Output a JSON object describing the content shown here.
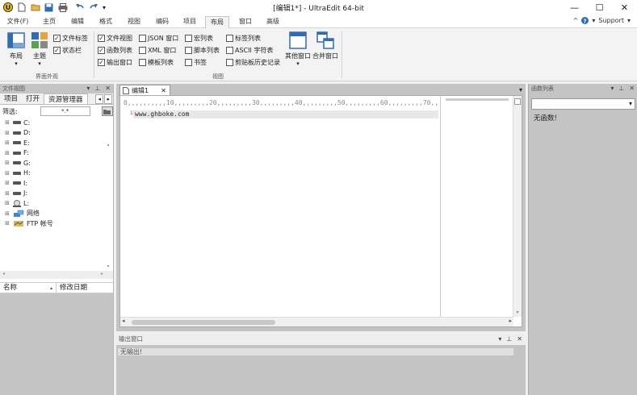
{
  "titlebar": {
    "title": "[编辑1*] - UltraEdit 64-bit",
    "controls": {
      "minimize": "—",
      "maximize": "☐",
      "close": "✕"
    }
  },
  "menu": {
    "tabs": [
      "文件(F)",
      "主页",
      "编辑",
      "格式",
      "视图",
      "编码",
      "项目",
      "布局",
      "窗口",
      "高级"
    ],
    "active": "布局",
    "support": "Support"
  },
  "ribbon": {
    "layout_btn": "布局",
    "theme_btn": "主题",
    "checks_group1": [
      {
        "label": "文件标签",
        "checked": true
      },
      {
        "label": "状态栏",
        "checked": true
      }
    ],
    "checks_col1": [
      {
        "label": "文件视图",
        "checked": true
      },
      {
        "label": "函数列表",
        "checked": true
      },
      {
        "label": "输出窗口",
        "checked": true
      }
    ],
    "checks_col2": [
      {
        "label": "JSON 窗口",
        "checked": false
      },
      {
        "label": "XML 窗口",
        "checked": false
      },
      {
        "label": "模板列表",
        "checked": false
      }
    ],
    "checks_col3": [
      {
        "label": "宏列表",
        "checked": false
      },
      {
        "label": "脚本列表",
        "checked": false
      },
      {
        "label": "书签",
        "checked": false
      }
    ],
    "checks_col4": [
      {
        "label": "标签列表",
        "checked": false
      },
      {
        "label": "ASCII 字符表",
        "checked": false
      },
      {
        "label": "剪贴板历史记录",
        "checked": false
      }
    ],
    "other_windows_btn": "其他窗口",
    "merge_windows_btn": "合并窗口",
    "group_labels": {
      "interface": "界面外观",
      "view": "视图"
    }
  },
  "left_panel": {
    "title": "文件视图",
    "tabs": [
      "项目",
      "打开",
      "资源管理器"
    ],
    "filter_label": "筛选:",
    "filter_value": "*.*",
    "tree": [
      {
        "label": "C:",
        "type": "drive"
      },
      {
        "label": "D:",
        "type": "drive"
      },
      {
        "label": "E:",
        "type": "drive"
      },
      {
        "label": "F:",
        "type": "drive"
      },
      {
        "label": "G:",
        "type": "drive"
      },
      {
        "label": "H:",
        "type": "drive"
      },
      {
        "label": "I:",
        "type": "drive"
      },
      {
        "label": "J:",
        "type": "drive"
      },
      {
        "label": "L:",
        "type": "drive"
      },
      {
        "label": "网络",
        "type": "network"
      },
      {
        "label": "FTP 帐号",
        "type": "ftp"
      }
    ],
    "columns": [
      "名称",
      "修改日期"
    ]
  },
  "editor": {
    "tab_label": "编辑1",
    "ruler": "0,,,,,,,,,,10,,,,,,,,,20,,,,,,,,,30,,,,,,,,,40,,,,,,,,,50,,,,,,,,,60,,,,,,,,,70,,,",
    "line_number": "1",
    "content": "www.ghboke.com"
  },
  "output": {
    "title": "输出窗口",
    "message": "无输出!"
  },
  "right_panel": {
    "title": "函数列表",
    "message": "无函数!"
  },
  "colors": {
    "panel_gray": "#c4c4c4",
    "ribbon_bg": "#f3f3f3",
    "accent_blue": "#2e6db4"
  }
}
